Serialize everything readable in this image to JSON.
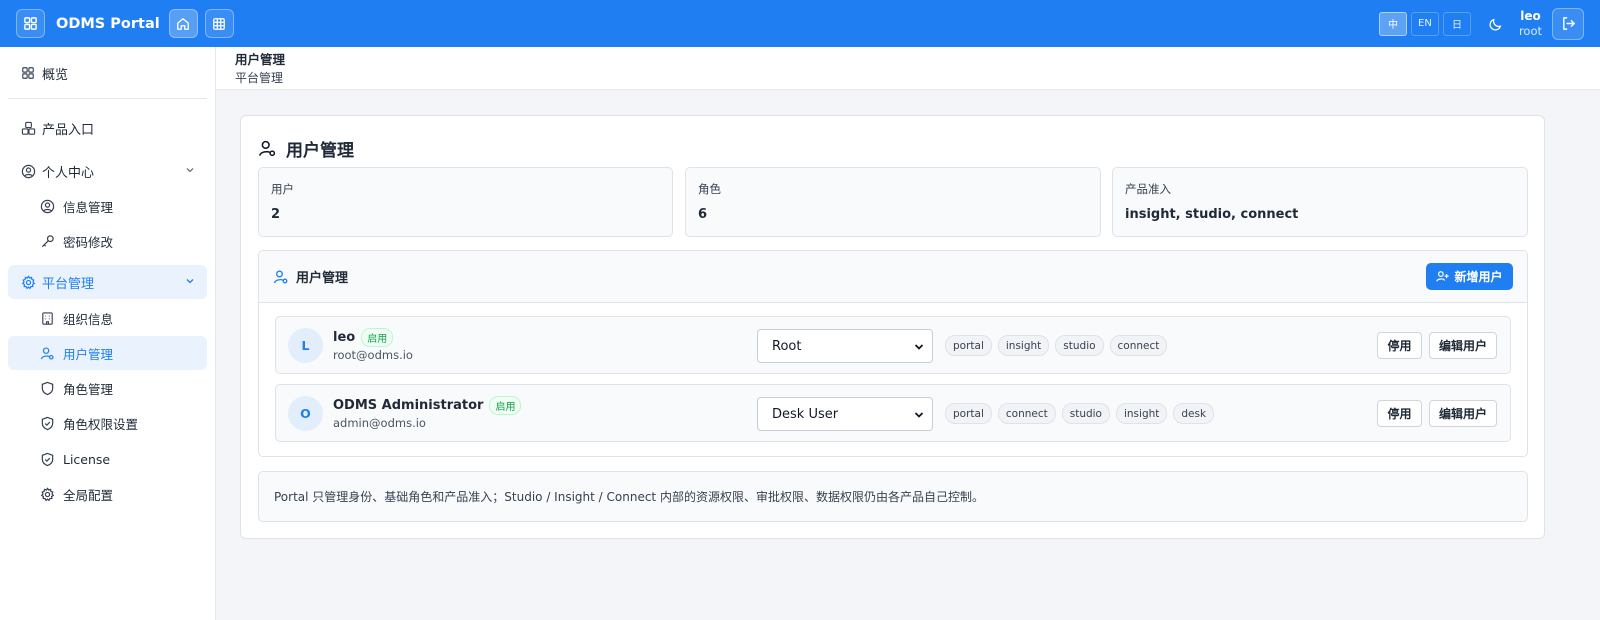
{
  "header": {
    "brand": "ODMS Portal",
    "langs": [
      "中",
      "EN",
      "日"
    ],
    "user_name": "leo",
    "user_role": "root"
  },
  "sidebar": {
    "overview": "概览",
    "product_entry": "产品入口",
    "personal_center": "个人中心",
    "info_manage": "信息管理",
    "password_change": "密码修改",
    "platform_manage": "平台管理",
    "org_info": "组织信息",
    "user_manage": "用户管理",
    "role_manage": "角色管理",
    "role_permission": "角色权限设置",
    "license": "License",
    "global_config": "全局配置"
  },
  "breadcrumb": {
    "title": "用户管理",
    "parent": "平台管理"
  },
  "page": {
    "title": "用户管理"
  },
  "stats": [
    {
      "label": "用户",
      "value": "2"
    },
    {
      "label": "角色",
      "value": "6"
    },
    {
      "label": "产品准入",
      "value": "insight, studio, connect"
    }
  ],
  "users_panel": {
    "title": "用户管理",
    "add_button": "新增用户",
    "disable_label": "停用",
    "edit_label": "编辑用户",
    "users": [
      {
        "initial": "L",
        "name": "leo",
        "status": "启用",
        "email": "root@odms.io",
        "role": "Root",
        "tags": [
          "portal",
          "insight",
          "studio",
          "connect"
        ]
      },
      {
        "initial": "O",
        "name": "ODMS Administrator",
        "status": "启用",
        "email": "admin@odms.io",
        "role": "Desk User",
        "tags": [
          "portal",
          "connect",
          "studio",
          "insight",
          "desk"
        ]
      }
    ]
  },
  "note": "Portal 只管理身份、基础角色和产品准入；Studio / Insight / Connect 内部的资源权限、审批权限、数据权限仍由各产品自己控制。",
  "colors": {
    "accent": "#1f7ff2",
    "status_green": "#16a34a"
  }
}
